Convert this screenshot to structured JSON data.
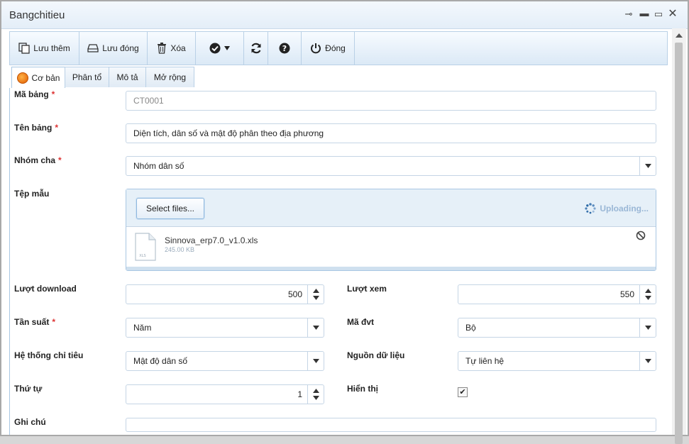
{
  "window": {
    "title": "Bangchitieu"
  },
  "toolbar": {
    "save_new": "Lưu thêm",
    "save_close": "Lưu đóng",
    "delete": "Xóa",
    "close": "Đóng"
  },
  "tabs": [
    "Cơ bản",
    "Phân tổ",
    "Mô tả",
    "Mở rộng"
  ],
  "form": {
    "ma_bang": {
      "label": "Mã bảng",
      "value": "CT0001"
    },
    "ten_bang": {
      "label": "Tên bảng",
      "value": "Diện tích, dân số và mật độ phân theo địa phương"
    },
    "nhom_cha": {
      "label": "Nhóm cha",
      "value": "Nhóm dân số"
    },
    "tep_mau": {
      "label": "Tệp mẫu"
    },
    "luot_download": {
      "label": "Lượt download",
      "value": "500"
    },
    "luot_xem": {
      "label": "Lượt xem",
      "value": "550"
    },
    "tan_suat": {
      "label": "Tần suất",
      "value": "Năm"
    },
    "ma_dvt": {
      "label": "Mã đvt",
      "value": "Bộ"
    },
    "he_thong_chi_tieu": {
      "label": "Hệ thống chỉ tiêu",
      "value": "Mật độ dân số"
    },
    "nguon_du_lieu": {
      "label": "Nguồn dữ liệu",
      "value": "Tự liên hệ"
    },
    "thu_tu": {
      "label": "Thứ tự",
      "value": "1"
    },
    "hien_thi": {
      "label": "Hiển thị",
      "checked": true
    },
    "ghi_chu": {
      "label": "Ghi chú"
    },
    "required_mark": "*"
  },
  "upload": {
    "select_label": "Select files...",
    "status": "Uploading...",
    "file_name": "Sinnova_erp7.0_v1.0.xls",
    "file_size": "245.00 KB",
    "file_ext": "XLS"
  }
}
